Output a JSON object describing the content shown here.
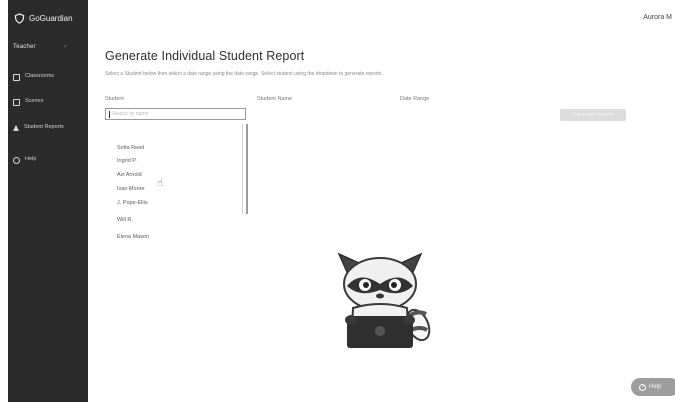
{
  "app": {
    "brand": "GoGuardian"
  },
  "header": {
    "user_name": "Aurora M"
  },
  "sidebar": {
    "section_label": "Teacher",
    "items": [
      {
        "label": "Classrooms",
        "icon": "classroom-icon"
      },
      {
        "label": "Scenes",
        "icon": "scenes-icon"
      },
      {
        "label": "Student Reports",
        "icon": "reports-icon"
      },
      {
        "label": "Help",
        "icon": "help-icon"
      }
    ]
  },
  "main": {
    "title": "Generate Individual Student Report",
    "description": "Select a Student below then select a date range using the date range. Select student using the dropdown to generate reports."
  },
  "form": {
    "student_label": "Student",
    "student_select_label": "Student Name",
    "date_label": "Date Range",
    "student_input_placeholder": "Search by name",
    "generate_button": "Generate Report",
    "student_options": [
      "Sofia Reed",
      "Ingrid P.",
      "Avi Arnold",
      "Ivan Moore",
      "J. Pope-Ellis",
      "Will R.",
      "Elena Mason"
    ]
  },
  "help": {
    "label": "Help"
  }
}
